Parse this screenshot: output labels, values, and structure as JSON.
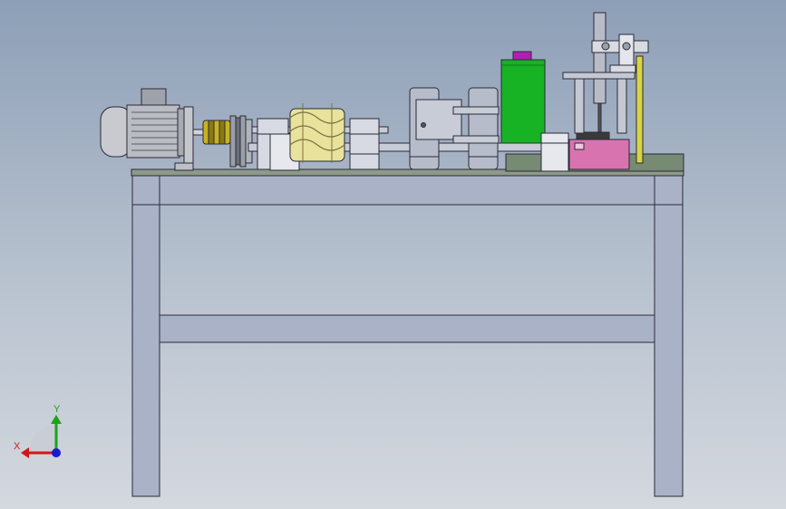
{
  "triad": {
    "x_label": "X",
    "y_label": "Y",
    "x_color": "#d01818",
    "y_color": "#1aa31a",
    "z_color": "#1a1ad0"
  },
  "colors": {
    "frame_fill": "#aab2c8",
    "frame_stroke": "#2a2a38",
    "motor_body": "#b9bcc2",
    "coupling_yellow": "#c9b21e",
    "cam_yellow": "#e8e29c",
    "cylinder_green": "#17b324",
    "cylinder_cap": "#b21fb0",
    "pink_block": "#d873b0",
    "base_plate": "#778a73",
    "strap_yellow": "#d8d640"
  }
}
